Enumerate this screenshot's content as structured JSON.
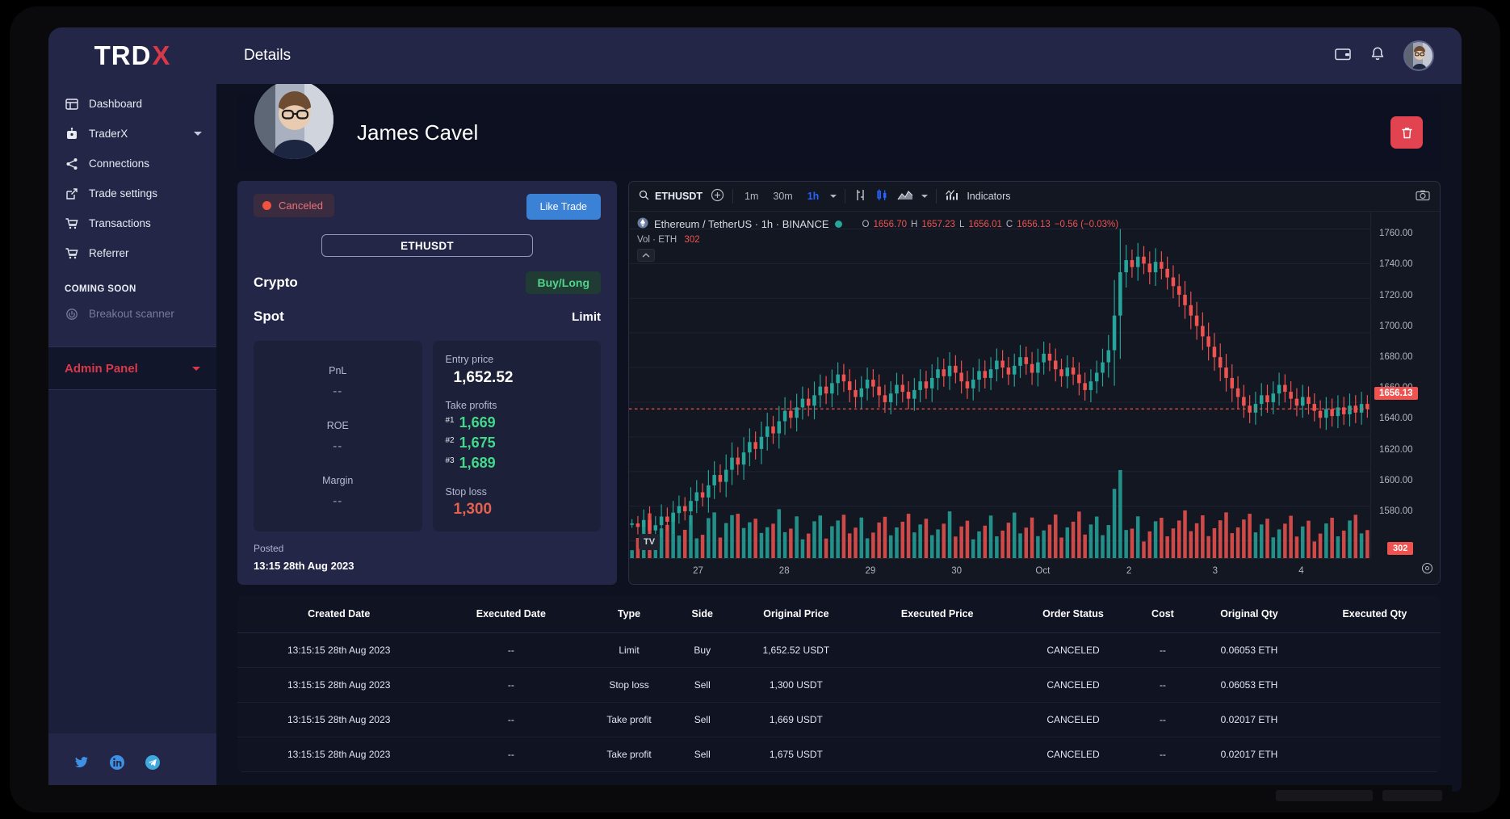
{
  "brand": {
    "name_main": "TRD",
    "name_accent": "X"
  },
  "sidebar": {
    "items": [
      {
        "label": "Dashboard",
        "icon": "dashboard-icon"
      },
      {
        "label": "TraderX",
        "icon": "robot-icon",
        "has_caret": true
      },
      {
        "label": "Connections",
        "icon": "share-icon"
      },
      {
        "label": "Trade settings",
        "icon": "edit-square-icon"
      },
      {
        "label": "Transactions",
        "icon": "cart-icon"
      },
      {
        "label": "Referrer",
        "icon": "cart-icon"
      }
    ],
    "section_heading": "COMING SOON",
    "coming_soon": [
      {
        "label": "Breakout scanner",
        "icon": "power-icon"
      }
    ],
    "admin_panel_label": "Admin Panel",
    "socials": [
      "twitter-icon",
      "linkedin-icon",
      "telegram-icon"
    ]
  },
  "topbar": {
    "title": "Details",
    "icons": [
      "wallet-icon",
      "bell-icon"
    ],
    "avatar": "user-avatar"
  },
  "profile": {
    "name": "James Cavel",
    "delete_label": "delete-trade"
  },
  "trade": {
    "status": "Canceled",
    "like_label": "Like Trade",
    "symbol": "ETHUSDT",
    "market_type": "Crypto",
    "direction": "Buy/Long",
    "account_type": "Spot",
    "order_type": "Limit",
    "pnl_label": "PnL",
    "pnl_value": "--",
    "roe_label": "ROE",
    "roe_value": "--",
    "margin_label": "Margin",
    "margin_value": "--",
    "entry_label": "Entry price",
    "entry_value": "1,652.52",
    "take_profits_label": "Take profits",
    "take_profits": [
      {
        "idx": "#1",
        "value": "1,669"
      },
      {
        "idx": "#2",
        "value": "1,675"
      },
      {
        "idx": "#3",
        "value": "1,689"
      }
    ],
    "stop_loss_label": "Stop loss",
    "stop_loss_value": "1,300",
    "posted_label": "Posted",
    "posted_value": "13:15 28th Aug 2023"
  },
  "chart": {
    "search_symbol": "ETHUSDT",
    "timeframes": [
      {
        "label": "1m",
        "active": false
      },
      {
        "label": "30m",
        "active": false
      },
      {
        "label": "1h",
        "active": true
      }
    ],
    "indicators_label": "Indicators",
    "legend_title": "Ethereum / TetherUS · 1h · BINANCE",
    "ohlc": {
      "o_key": "O",
      "o_val": "1656.70",
      "h_key": "H",
      "h_val": "1657.23",
      "l_key": "L",
      "l_val": "1656.01",
      "c_key": "C",
      "c_val": "1656.13",
      "change": "−0.56 (−0.03%)"
    },
    "volume_label": "Vol · ETH",
    "volume_value": "302",
    "last_price_badge": "1656.13",
    "volume_badge": "302",
    "tv_logo": "TV"
  },
  "chart_data": {
    "type": "line",
    "title": "Ethereum / TetherUS · 1h · BINANCE",
    "xlabel": "",
    "ylabel": "",
    "ylim": [
      1570,
      1770
    ],
    "yticks": [
      1760.0,
      1740.0,
      1720.0,
      1700.0,
      1680.0,
      1660.0,
      1640.0,
      1620.0,
      1600.0,
      1580.0
    ],
    "ytick_labels": [
      "1760.00",
      "1740.00",
      "1720.00",
      "1700.00",
      "1680.00",
      "1660.00",
      "1640.00",
      "1620.00",
      "1600.00",
      "1580.00"
    ],
    "xticks": [
      "27",
      "28",
      "29",
      "30",
      "Oct",
      "2",
      "3",
      "4"
    ],
    "grid": true,
    "legend": "top-left",
    "last_price": 1656.13,
    "open": 1656.7,
    "high": 1657.23,
    "low": 1656.01,
    "close": 1656.13,
    "change_abs": -0.56,
    "change_pct": -0.03,
    "volume": 302,
    "series": [
      {
        "name": "ETHUSDT close (1h)",
        "values": [
          1590,
          1588,
          1592,
          1586,
          1589,
          1594,
          1591,
          1596,
          1600,
          1597,
          1603,
          1608,
          1605,
          1612,
          1618,
          1614,
          1621,
          1628,
          1624,
          1631,
          1637,
          1633,
          1640,
          1646,
          1642,
          1649,
          1655,
          1651,
          1657,
          1662,
          1658,
          1664,
          1669,
          1665,
          1671,
          1676,
          1672,
          1667,
          1663,
          1668,
          1673,
          1669,
          1664,
          1660,
          1665,
          1670,
          1666,
          1662,
          1667,
          1672,
          1668,
          1674,
          1679,
          1675,
          1681,
          1677,
          1672,
          1668,
          1673,
          1678,
          1674,
          1679,
          1684,
          1680,
          1676,
          1681,
          1686,
          1682,
          1677,
          1683,
          1688,
          1684,
          1679,
          1675,
          1680,
          1676,
          1671,
          1667,
          1672,
          1677,
          1683,
          1690,
          1710,
          1735,
          1742,
          1738,
          1744,
          1740,
          1735,
          1741,
          1737,
          1732,
          1727,
          1722,
          1716,
          1710,
          1704,
          1698,
          1692,
          1686,
          1680,
          1674,
          1668,
          1663,
          1658,
          1654,
          1659,
          1664,
          1660,
          1665,
          1670,
          1666,
          1662,
          1658,
          1663,
          1659,
          1655,
          1651,
          1656,
          1652,
          1657,
          1653,
          1658,
          1654,
          1659,
          1656.13
        ]
      }
    ],
    "volume_series": {
      "name": "Volume",
      "note": "histogram below price, teal = up bar, red = down bar"
    }
  },
  "orders": {
    "columns": [
      "Created Date",
      "Executed Date",
      "Type",
      "Side",
      "Original Price",
      "Executed Price",
      "Order Status",
      "Cost",
      "Original Qty",
      "Executed Qty"
    ],
    "rows": [
      [
        "13:15:15 28th Aug 2023",
        "--",
        "Limit",
        "Buy",
        "1,652.52 USDT",
        "",
        "CANCELED",
        "--",
        "0.06053 ETH",
        ""
      ],
      [
        "13:15:15 28th Aug 2023",
        "--",
        "Stop loss",
        "Sell",
        "1,300 USDT",
        "",
        "CANCELED",
        "--",
        "0.06053 ETH",
        ""
      ],
      [
        "13:15:15 28th Aug 2023",
        "--",
        "Take profit",
        "Sell",
        "1,669 USDT",
        "",
        "CANCELED",
        "--",
        "0.02017 ETH",
        ""
      ],
      [
        "13:15:15 28th Aug 2023",
        "--",
        "Take profit",
        "Sell",
        "1,675 USDT",
        "",
        "CANCELED",
        "--",
        "0.02017 ETH",
        ""
      ]
    ]
  },
  "colors": {
    "accent_red": "#d8394a",
    "sidebar": "#232647",
    "bg": "#0e1220",
    "green": "#43d98a",
    "blue": "#3b82d6"
  }
}
